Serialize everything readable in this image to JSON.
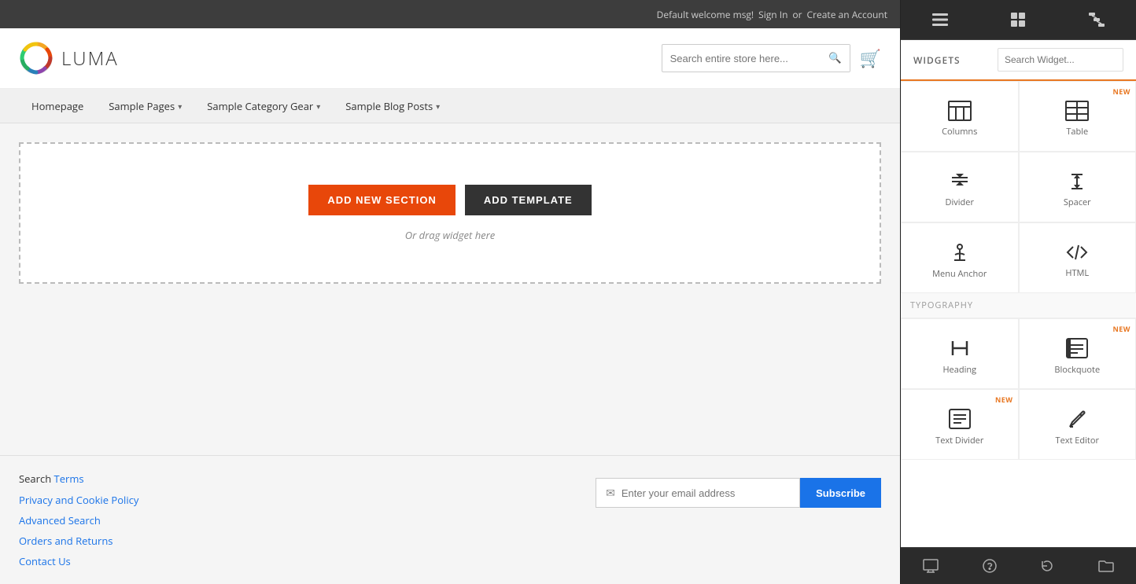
{
  "topbar": {
    "welcome": "Default welcome msg!",
    "sign_in": "Sign In",
    "or": "or",
    "create_account": "Create an Account"
  },
  "header": {
    "logo_text": "LUMA",
    "search_placeholder": "Search entire store here...",
    "cart_label": "Cart"
  },
  "nav": {
    "items": [
      {
        "label": "Homepage",
        "has_dropdown": false
      },
      {
        "label": "Sample Pages",
        "has_dropdown": true
      },
      {
        "label": "Sample Category Gear",
        "has_dropdown": true
      },
      {
        "label": "Sample Blog Posts",
        "has_dropdown": true
      }
    ]
  },
  "builder": {
    "add_section_label": "ADD NEW SECTION",
    "add_template_label": "ADD TEMPLATE",
    "drag_hint": "Or drag widget here"
  },
  "footer": {
    "links": [
      {
        "text": "Search Terms",
        "is_link": false,
        "label_part": "Search ",
        "link_part": "Terms"
      },
      {
        "text": "Privacy and Cookie Policy",
        "is_link": true
      },
      {
        "text": "Advanced Search",
        "is_link": true
      },
      {
        "text": "Orders and Returns",
        "is_link": true
      },
      {
        "text": "Contact Us",
        "is_link": true
      }
    ],
    "email_placeholder": "Enter your email address",
    "subscribe_label": "Subscribe"
  },
  "sidebar": {
    "title": "WIDGETS",
    "search_placeholder": "Search Widget...",
    "collapse_icon": "❯",
    "widgets": [
      {
        "label": "Columns",
        "icon": "columns",
        "is_new": false
      },
      {
        "label": "Table",
        "icon": "table",
        "is_new": true
      },
      {
        "label": "Divider",
        "icon": "divider",
        "is_new": false
      },
      {
        "label": "Spacer",
        "icon": "spacer",
        "is_new": false
      },
      {
        "label": "Menu Anchor",
        "icon": "anchor",
        "is_new": false
      },
      {
        "label": "HTML",
        "icon": "html",
        "is_new": false
      }
    ],
    "typography_label": "TYPOGRAPHY",
    "typography_widgets": [
      {
        "label": "Heading",
        "icon": "heading",
        "is_new": false
      },
      {
        "label": "Blockquote",
        "icon": "blockquote",
        "is_new": true
      },
      {
        "label": "Text Divider",
        "icon": "text-divider",
        "is_new": true
      },
      {
        "label": "Text Editor",
        "icon": "text-editor",
        "is_new": false
      }
    ],
    "bottom_tools": [
      {
        "label": "monitor-icon",
        "symbol": "🖥"
      },
      {
        "label": "help-icon",
        "symbol": "?"
      },
      {
        "label": "history-icon",
        "symbol": "↺"
      },
      {
        "label": "folder-icon",
        "symbol": "📁"
      }
    ]
  }
}
